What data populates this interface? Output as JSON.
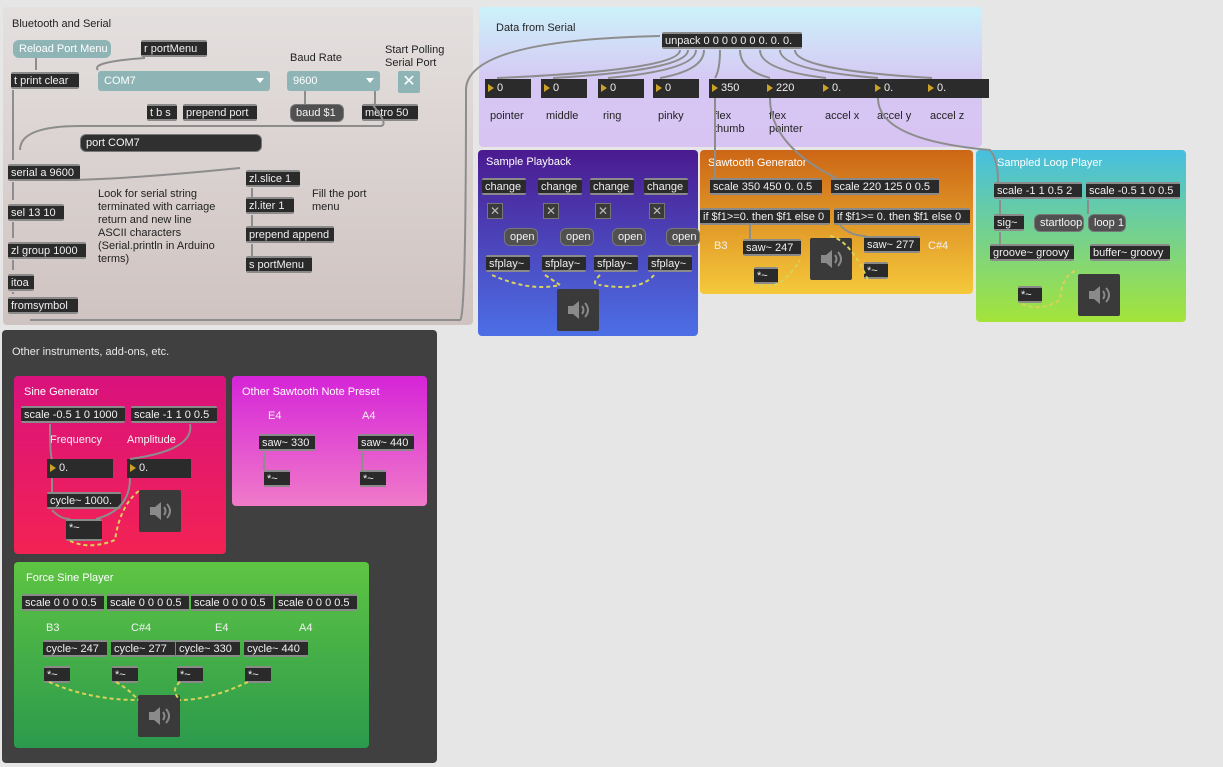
{
  "bt": {
    "title": "Bluetooth and Serial",
    "reload": "Reload Port Menu",
    "r_portmenu": "r portMenu",
    "tprint": "t print clear",
    "port_menu": "COM7",
    "baud_label": "Baud Rate",
    "baud_menu": "9600",
    "polling_label": "Start Polling Serial Port",
    "tbs": "t b s",
    "prepend_port": "prepend port",
    "baud_msg": "baud $1",
    "metro": "metro 50",
    "port_msg": "port COM7",
    "serial": "serial a 9600",
    "sel": "sel 13 10",
    "zlgroup": "zl group 1000",
    "itoa": "itoa",
    "fromsymbol": "fromsymbol",
    "comment": "Look for serial string terminated with carriage return and new line ASCII characters (Serial.println in Arduino terms)",
    "zlslice": "zl.slice 1",
    "zliter": "zl.iter 1",
    "prepend_append": "prepend append",
    "s_portmenu": "s portMenu",
    "fill_comment": "Fill the port menu"
  },
  "serial": {
    "title": "Data from Serial",
    "unpack": "unpack 0 0 0 0 0 0 0. 0. 0.",
    "numbers": [
      "0",
      "0",
      "0",
      "0",
      "350",
      "220",
      "0.",
      "0.",
      "0."
    ],
    "labels": [
      "pointer",
      "middle",
      "ring",
      "pinky",
      "flex thumb",
      "flex pointer",
      "accel x",
      "accel y",
      "accel z"
    ]
  },
  "playback": {
    "title": "Sample Playback",
    "change": "change",
    "open": "open",
    "sfplay": "sfplay~"
  },
  "saw": {
    "title": "Sawtooth Generator",
    "scale1": "scale 350 450 0. 0.5",
    "scale2": "scale 220 125 0 0.5",
    "if1": "if $f1>=0. then $f1 else 0",
    "if2": "if $f1>= 0. then $f1 else 0",
    "b3": "B3",
    "saw247": "saw~ 247",
    "saw277": "saw~ 277",
    "cs4": "C#4",
    "mul": "*~"
  },
  "loop": {
    "title": "Sampled Loop Player",
    "scale1": "scale -1 1 0.5 2",
    "scale2": "scale -0.5 1 0 0.5",
    "sig": "sig~",
    "startloop": "startloop",
    "loop1": "loop 1",
    "groove": "groove~ groovy",
    "buffer": "buffer~ groovy",
    "mul": "*~"
  },
  "other": {
    "title": "Other instruments, add-ons, etc."
  },
  "sine": {
    "title": "Sine Generator",
    "scale1": "scale -0.5 1 0 1000",
    "scale2": "scale -1 1 0 0.5",
    "freq": "Frequency",
    "amp": "Amplitude",
    "n1": "0.",
    "n2": "0.",
    "cycle": "cycle~ 1000.",
    "mul": "*~"
  },
  "preset": {
    "title": "Other Sawtooth Note Preset",
    "e4": "E4",
    "a4": "A4",
    "saw330": "saw~ 330",
    "saw440": "saw~ 440",
    "mul": "*~"
  },
  "force": {
    "title": "Force Sine Player",
    "scale": "scale 0 0 0 0.5",
    "notes": [
      "B3",
      "C#4",
      "E4",
      "A4"
    ],
    "cycles": [
      "cycle~ 247",
      "cycle~ 277",
      "cycle~ 330",
      "cycle~ 440"
    ],
    "mul": "*~"
  },
  "icons": {
    "speaker": "speaker-icon",
    "toggle": "toggle-x-icon",
    "menu": "dropdown-arrow-icon"
  },
  "colors": {
    "bt_bg": "#dcd3d1",
    "serial_bg": "#dccff5",
    "playback_bg": "#4050d0",
    "saw_bg": "#e08a1e",
    "loop_bg": "#5cc6cf",
    "other_bg": "#404040",
    "sine_bg": "#e0245f",
    "preset_bg": "#e060d0",
    "force_bg": "#3aa84a"
  }
}
